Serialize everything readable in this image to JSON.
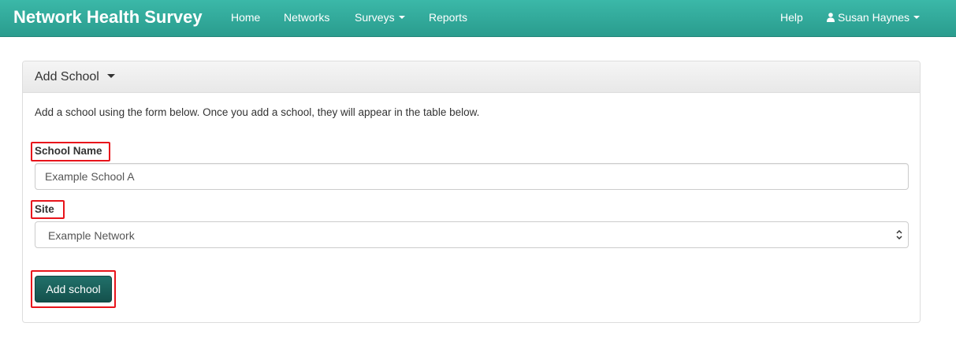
{
  "navbar": {
    "brand": "Network Health Survey",
    "links": [
      "Home",
      "Networks",
      "Surveys",
      "Reports"
    ],
    "help": "Help",
    "user": "Susan Haynes"
  },
  "panel": {
    "title": "Add School",
    "intro": "Add a school using the form below. Once you add a school, they will appear in the table below.",
    "school_name_label": "School Name",
    "school_name_value": "Example School A",
    "site_label": "Site",
    "site_selected": "Example Network",
    "submit_label": "Add school"
  },
  "colors": {
    "navbar": "#2fa99a",
    "highlight": "#e8141b",
    "button": "#1b625d"
  }
}
